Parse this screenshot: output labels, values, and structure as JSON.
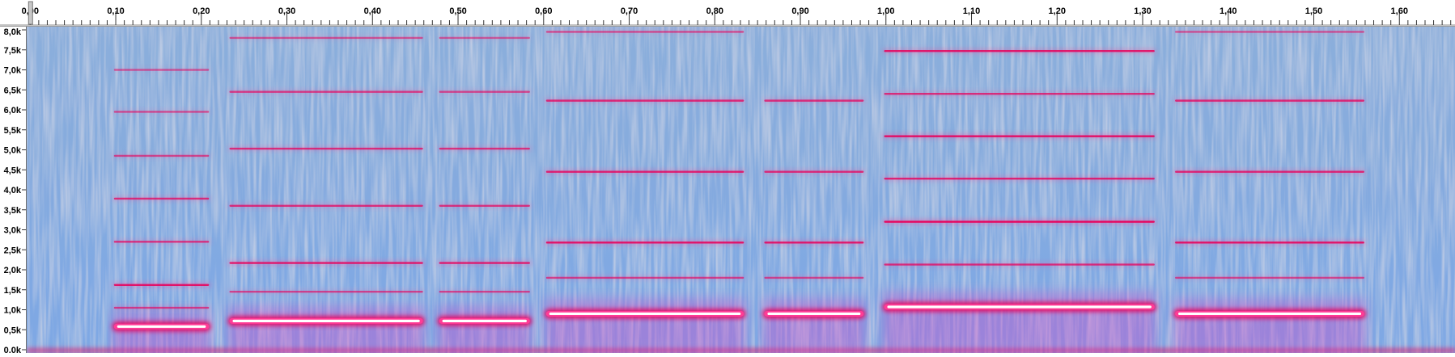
{
  "chart_data": {
    "type": "heatmap",
    "x_tick_labels": [
      "0,00",
      "0,10",
      "0,20",
      "0,30",
      "0,40",
      "0,50",
      "0,60",
      "0,70",
      "0,80",
      "0,90",
      "1,00",
      "1,10",
      "1,20",
      "1,30",
      "1,40",
      "1,50",
      "1,60"
    ],
    "x_ticks": [
      0.0,
      0.1,
      0.2,
      0.3,
      0.4,
      0.5,
      0.6,
      0.7,
      0.8,
      0.9,
      1.0,
      1.1,
      1.2,
      1.3,
      1.4,
      1.5,
      1.6
    ],
    "y_tick_labels": [
      "8,0k",
      "7,5k",
      "7,0k",
      "6,5k",
      "6,0k",
      "5,5k",
      "5,0k",
      "4,5k",
      "4,0k",
      "3,5k",
      "3,0k",
      "2,5k",
      "2,0k",
      "1,5k",
      "1,0k",
      "0,5k",
      "0,0k"
    ],
    "y_ticks": [
      8000,
      7500,
      7000,
      6500,
      6000,
      5500,
      5000,
      4500,
      4000,
      3500,
      3000,
      2500,
      2000,
      1500,
      1000,
      500,
      0
    ],
    "xlim": [
      -0.005,
      1.665
    ],
    "ylim": [
      0,
      8000
    ],
    "colors": {
      "background": "#86abde",
      "harmonic": "#e8005a",
      "harmonic_glow": "#ff3c96",
      "fundamental_core": "#ffffff",
      "noise_pink": "#d040c8"
    },
    "notes": [
      {
        "start": 0.095,
        "end": 0.21,
        "fundamental": 580,
        "harmonics": [
          {
            "f": 1050,
            "s": 0.4
          },
          {
            "f": 1620,
            "s": 0.8
          },
          {
            "f": 2700,
            "s": 0.5
          },
          {
            "f": 3780,
            "s": 0.55
          },
          {
            "f": 4850,
            "s": 0.35
          },
          {
            "f": 5950,
            "s": 0.3
          },
          {
            "f": 7000,
            "s": 0.2
          }
        ]
      },
      {
        "start": 0.23,
        "end": 0.46,
        "fundamental": 720,
        "harmonics": [
          {
            "f": 1450,
            "s": 0.35
          },
          {
            "f": 2170,
            "s": 0.75
          },
          {
            "f": 3600,
            "s": 0.55
          },
          {
            "f": 5030,
            "s": 0.55
          },
          {
            "f": 6450,
            "s": 0.45
          },
          {
            "f": 7800,
            "s": 0.25
          }
        ]
      },
      {
        "start": 0.475,
        "end": 0.585,
        "fundamental": 720,
        "harmonics": [
          {
            "f": 1450,
            "s": 0.35
          },
          {
            "f": 2170,
            "s": 0.7
          },
          {
            "f": 3600,
            "s": 0.5
          },
          {
            "f": 5030,
            "s": 0.5
          },
          {
            "f": 6450,
            "s": 0.35
          },
          {
            "f": 7800,
            "s": 0.2
          }
        ]
      },
      {
        "start": 0.6,
        "end": 0.835,
        "fundamental": 900,
        "harmonics": [
          {
            "f": 1800,
            "s": 0.4
          },
          {
            "f": 2680,
            "s": 0.8
          },
          {
            "f": 4450,
            "s": 0.7
          },
          {
            "f": 6230,
            "s": 0.6
          },
          {
            "f": 7950,
            "s": 0.3
          }
        ]
      },
      {
        "start": 0.855,
        "end": 0.975,
        "fundamental": 900,
        "harmonics": [
          {
            "f": 1800,
            "s": 0.35
          },
          {
            "f": 2680,
            "s": 0.75
          },
          {
            "f": 4450,
            "s": 0.6
          },
          {
            "f": 6230,
            "s": 0.55
          }
        ]
      },
      {
        "start": 0.995,
        "end": 1.315,
        "fundamental": 1070,
        "harmonics": [
          {
            "f": 2130,
            "s": 0.55
          },
          {
            "f": 3200,
            "s": 0.95
          },
          {
            "f": 4280,
            "s": 0.65
          },
          {
            "f": 5340,
            "s": 0.85
          },
          {
            "f": 6400,
            "s": 0.55
          },
          {
            "f": 7470,
            "s": 0.75
          }
        ]
      },
      {
        "start": 1.335,
        "end": 1.56,
        "fundamental": 900,
        "harmonics": [
          {
            "f": 1800,
            "s": 0.35
          },
          {
            "f": 2680,
            "s": 0.8
          },
          {
            "f": 4450,
            "s": 0.65
          },
          {
            "f": 6230,
            "s": 0.6
          },
          {
            "f": 7950,
            "s": 0.25
          }
        ]
      }
    ]
  }
}
